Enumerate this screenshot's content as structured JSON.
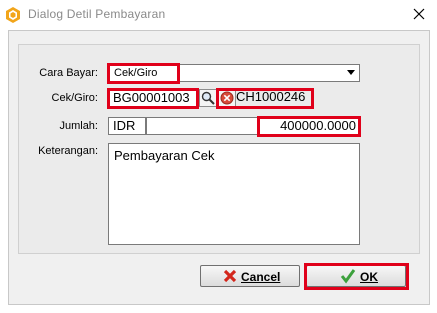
{
  "window": {
    "title": "Dialog Detil Pembayaran"
  },
  "form": {
    "cara_bayar": {
      "label": "Cara Bayar:",
      "value": "Cek/Giro"
    },
    "cek_giro": {
      "label": "Cek/Giro:",
      "code": "BG00001003",
      "ref": "CH1000246"
    },
    "jumlah": {
      "label": "Jumlah:",
      "currency": "IDR",
      "amount": "400000.0000"
    },
    "keterangan": {
      "label": "Keterangan:",
      "value": "Pembayaran Cek"
    }
  },
  "buttons": {
    "cancel_label": "Cancel",
    "ok_label": "OK"
  },
  "icons": {
    "app": "app-logo-icon",
    "search": "magnifier-icon",
    "clear": "clear-icon",
    "cancel": "red-x-icon",
    "ok": "green-check-icon"
  },
  "colors": {
    "highlight": "#e0001a"
  }
}
